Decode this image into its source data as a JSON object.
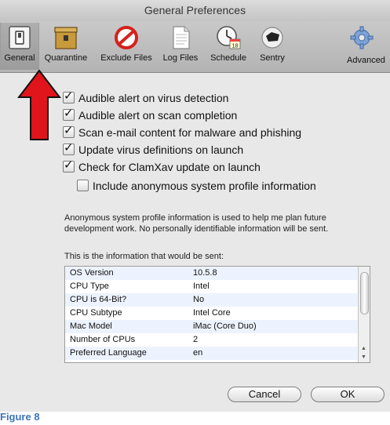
{
  "window": {
    "title": "General Preferences"
  },
  "toolbar": {
    "items": [
      {
        "label": "General",
        "icon": "general-switch-icon"
      },
      {
        "label": "Quarantine",
        "icon": "quarantine-box-icon"
      },
      {
        "label": "Exclude Files",
        "icon": "exclude-no-icon"
      },
      {
        "label": "Log Files",
        "icon": "log-document-icon"
      },
      {
        "label": "Schedule",
        "icon": "clock-calendar-icon"
      },
      {
        "label": "Sentry",
        "icon": "sentry-icon"
      },
      {
        "label": "Advanced",
        "icon": "gear-icon"
      }
    ],
    "selected": "General"
  },
  "options": [
    {
      "label": "Audible alert on virus detection",
      "checked": true
    },
    {
      "label": "Audible alert on scan completion",
      "checked": true
    },
    {
      "label": "Scan e-mail content for malware and phishing",
      "checked": true
    },
    {
      "label": "Update virus definitions on launch",
      "checked": true
    },
    {
      "label": "Check for ClamXav update on launch",
      "checked": true
    },
    {
      "label": "Include anonymous system profile information",
      "checked": false
    }
  ],
  "profile_note": "Anonymous system profile information is used to help me plan future development work. No personally identifiable information will be sent.",
  "sent_label": "This is the information that would be sent:",
  "info_table": [
    {
      "key": "OS Version",
      "value": "10.5.8"
    },
    {
      "key": "CPU Type",
      "value": "Intel"
    },
    {
      "key": "CPU is 64-Bit?",
      "value": "No"
    },
    {
      "key": "CPU Subtype",
      "value": "Intel Core"
    },
    {
      "key": "Mac Model",
      "value": "iMac (Core Duo)"
    },
    {
      "key": "Number of CPUs",
      "value": "2"
    },
    {
      "key": "Preferred Language",
      "value": "en"
    }
  ],
  "buttons": {
    "cancel": "Cancel",
    "ok": "OK"
  },
  "caption": "Figure 8",
  "colors": {
    "arrow": "#e0141b",
    "caption": "#3d73b7"
  }
}
